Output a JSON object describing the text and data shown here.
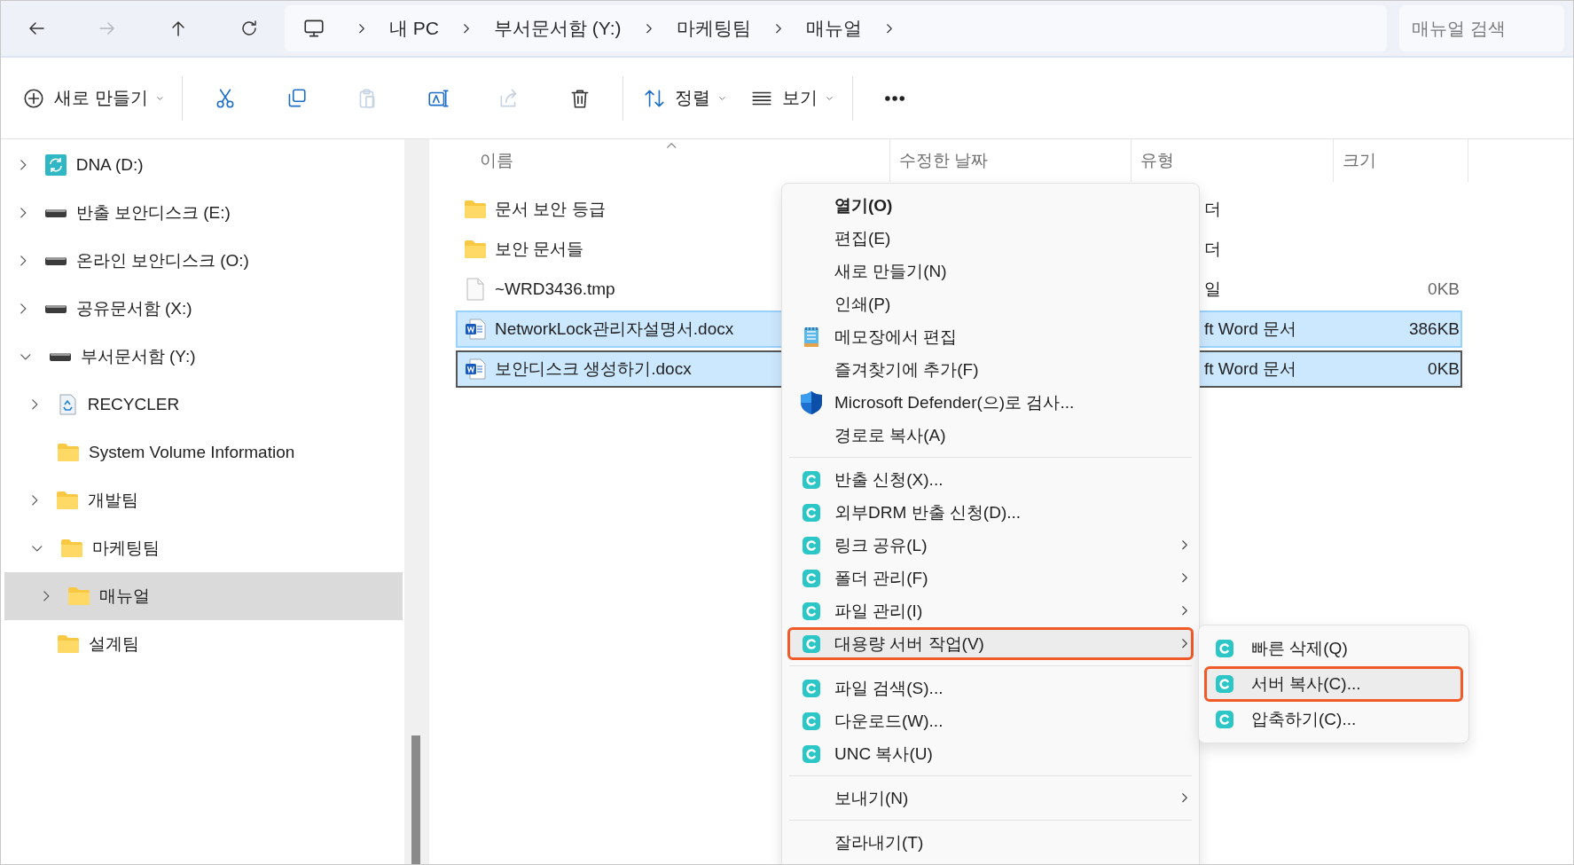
{
  "nav_buttons": [
    {
      "kind": "back",
      "disabled": false
    },
    {
      "kind": "forward",
      "disabled": true
    },
    {
      "kind": "up",
      "disabled": false
    },
    {
      "kind": "refresh",
      "disabled": false
    }
  ],
  "breadcrumb": {
    "items": [
      "내 PC",
      "부서문서함 (Y:)",
      "마케팅팀",
      "매뉴얼"
    ]
  },
  "search": {
    "placeholder": "매뉴얼 검색"
  },
  "toolbar": {
    "items": [
      {
        "kind": "new",
        "label": "새로 만들기",
        "dropdown": true,
        "disabled": false
      },
      {
        "kind": "separator"
      },
      {
        "kind": "cut",
        "disabled": false
      },
      {
        "kind": "copy",
        "disabled": false
      },
      {
        "kind": "paste",
        "disabled": true
      },
      {
        "kind": "rename",
        "disabled": false
      },
      {
        "kind": "share",
        "disabled": true
      },
      {
        "kind": "delete",
        "disabled": false
      },
      {
        "kind": "separator"
      },
      {
        "kind": "sort",
        "label": "정렬",
        "dropdown": true,
        "disabled": false
      },
      {
        "kind": "view",
        "label": "보기",
        "dropdown": true,
        "disabled": false
      },
      {
        "kind": "separator"
      },
      {
        "kind": "more",
        "disabled": false
      }
    ]
  },
  "sidebar": {
    "items": [
      {
        "label": "DNA (D:)",
        "kind": "sync-drive",
        "expandable": true,
        "expanded": false,
        "selected": false
      },
      {
        "label": "반출 보안디스크 (E:)",
        "kind": "drive",
        "expandable": true,
        "expanded": false,
        "selected": false
      },
      {
        "label": "온라인 보안디스크 (O:)",
        "kind": "drive",
        "expandable": true,
        "expanded": false,
        "selected": false
      },
      {
        "label": "공유문서함 (X:)",
        "kind": "drive",
        "expandable": true,
        "expanded": false,
        "selected": false
      },
      {
        "label": "부서문서함 (Y:)",
        "kind": "drive",
        "expandable": true,
        "expanded": true,
        "selected": false,
        "children": [
          {
            "label": "RECYCLER",
            "kind": "recycler",
            "expandable": true,
            "expanded": false,
            "selected": false
          },
          {
            "label": "System Volume Information",
            "kind": "folder",
            "expandable": false,
            "selected": false
          },
          {
            "label": "개발팀",
            "kind": "folder",
            "expandable": true,
            "expanded": false,
            "selected": false
          },
          {
            "label": "마케팅팀",
            "kind": "folder",
            "expandable": true,
            "expanded": true,
            "selected": false,
            "children": [
              {
                "label": "매뉴얼",
                "kind": "folder",
                "expandable": true,
                "expanded": false,
                "selected": true
              }
            ]
          },
          {
            "label": "설계팀",
            "kind": "folder",
            "expandable": false,
            "selected": false
          }
        ]
      }
    ]
  },
  "file_list": {
    "columns": [
      {
        "label": "이름",
        "sorted": true
      },
      {
        "label": "수정한 날짜",
        "sorted": false
      },
      {
        "label": "유형",
        "sorted": false
      },
      {
        "label": "크기",
        "sorted": false
      }
    ],
    "rows": [
      {
        "name": "문서 보안 등급",
        "kind": "folder",
        "type": "더",
        "selected": false,
        "focused": false
      },
      {
        "name": "보안 문서들",
        "kind": "folder",
        "type": "더",
        "selected": false,
        "focused": false
      },
      {
        "name": "~WRD3436.tmp",
        "kind": "file",
        "type": "일",
        "size": "0KB",
        "selected": false,
        "focused": false
      },
      {
        "name": "NetworkLock관리자설명서.docx",
        "kind": "word",
        "type": "ft Word 문서",
        "size": "386KB",
        "selected": true,
        "focused": false
      },
      {
        "name": "보안디스크 생성하기.docx",
        "kind": "word",
        "type": "ft Word 문서",
        "size": "0KB",
        "selected": true,
        "focused": true
      }
    ]
  },
  "context_menu": {
    "groups": [
      {
        "items": [
          {
            "label": "열기(O)",
            "kind": "plain",
            "default": true,
            "submenu": false,
            "highlighted": false
          },
          {
            "label": "편집(E)",
            "kind": "plain",
            "default": false,
            "submenu": false,
            "highlighted": false
          },
          {
            "label": "새로 만들기(N)",
            "kind": "plain",
            "default": false,
            "submenu": false,
            "highlighted": false
          },
          {
            "label": "인쇄(P)",
            "kind": "plain",
            "default": false,
            "submenu": false,
            "highlighted": false
          },
          {
            "label": "메모장에서 편집",
            "kind": "notepad",
            "default": false,
            "submenu": false,
            "highlighted": false
          },
          {
            "label": "즐겨찾기에 추가(F)",
            "kind": "plain",
            "default": false,
            "submenu": false,
            "highlighted": false
          },
          {
            "label": "Microsoft Defender(으)로 검사...",
            "kind": "defender",
            "default": false,
            "submenu": false,
            "highlighted": false
          },
          {
            "label": "경로로 복사(A)",
            "kind": "plain",
            "default": false,
            "submenu": false,
            "highlighted": false
          }
        ]
      },
      {
        "items": [
          {
            "label": "반출 신청(X)...",
            "kind": "c-app",
            "default": false,
            "submenu": false,
            "highlighted": false
          },
          {
            "label": "외부DRM 반출 신청(D)...",
            "kind": "c-app",
            "default": false,
            "submenu": false,
            "highlighted": false
          },
          {
            "label": "링크 공유(L)",
            "kind": "c-app",
            "default": false,
            "submenu": true,
            "highlighted": false
          },
          {
            "label": "폴더 관리(F)",
            "kind": "c-app",
            "default": false,
            "submenu": true,
            "highlighted": false
          },
          {
            "label": "파일 관리(I)",
            "kind": "c-app",
            "default": false,
            "submenu": true,
            "highlighted": false
          },
          {
            "label": "대용량 서버 작업(V)",
            "kind": "c-app",
            "default": false,
            "submenu": true,
            "highlighted": true
          }
        ]
      },
      {
        "items": [
          {
            "label": "파일 검색(S)...",
            "kind": "c-app",
            "default": false,
            "submenu": false,
            "highlighted": false
          },
          {
            "label": "다운로드(W)...",
            "kind": "c-app",
            "default": false,
            "submenu": false,
            "highlighted": false
          },
          {
            "label": "UNC 복사(U)",
            "kind": "c-app",
            "default": false,
            "submenu": false,
            "highlighted": false
          }
        ]
      },
      {
        "items": [
          {
            "label": "보내기(N)",
            "kind": "plain",
            "default": false,
            "submenu": true,
            "highlighted": false
          }
        ]
      },
      {
        "items": [
          {
            "label": "잘라내기(T)",
            "kind": "plain",
            "default": false,
            "submenu": false,
            "highlighted": false
          }
        ]
      }
    ]
  },
  "submenu": {
    "items": [
      {
        "label": "빠른 삭제(Q)",
        "kind": "c-app",
        "highlighted": false
      },
      {
        "label": "서버 복사(C)...",
        "kind": "c-app",
        "highlighted": true
      },
      {
        "label": "압축하기(C)...",
        "kind": "c-app",
        "highlighted": false
      }
    ]
  }
}
